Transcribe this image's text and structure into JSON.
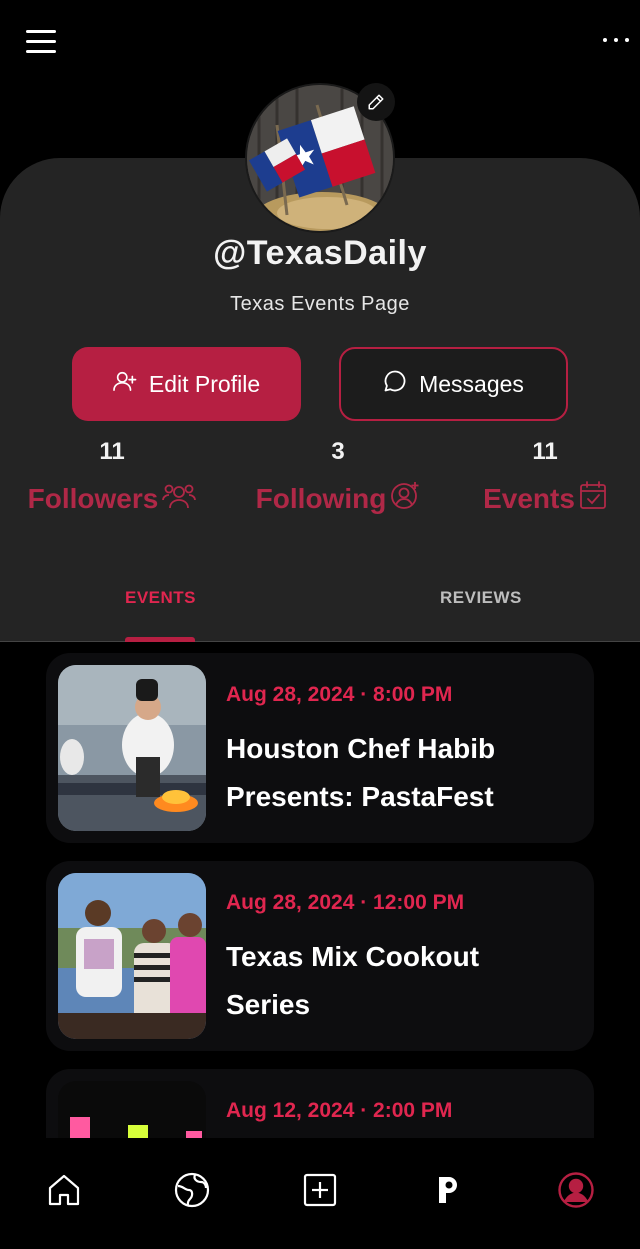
{
  "header": {
    "menu_icon": "hamburger-menu-icon",
    "more_icon": "more-dots-icon"
  },
  "profile": {
    "username": "@TexasDaily",
    "bio": "Texas Events Page",
    "edit_icon": "pencil-icon"
  },
  "buttons": {
    "edit_profile": "Edit Profile",
    "messages": "Messages"
  },
  "stats": [
    {
      "count": "11",
      "label": "Followers",
      "icon": "followers-icon"
    },
    {
      "count": "3",
      "label": "Following",
      "icon": "following-icon"
    },
    {
      "count": "11",
      "label": "Events",
      "icon": "calendar-icon"
    }
  ],
  "tabs": [
    {
      "label": "EVENTS",
      "active": true
    },
    {
      "label": "REVIEWS",
      "active": false
    }
  ],
  "events": [
    {
      "date": "Aug 28, 2024 · 8:00 PM",
      "title": "Houston Chef Habib Presents: PastaFest"
    },
    {
      "date": "Aug 28, 2024 · 12:00 PM",
      "title": "Texas Mix Cookout Series"
    },
    {
      "date": "Aug 12, 2024 · 2:00 PM",
      "title": ""
    }
  ],
  "bottom_nav": [
    {
      "name": "home",
      "icon": "home-icon"
    },
    {
      "name": "explore",
      "icon": "globe-icon"
    },
    {
      "name": "create",
      "icon": "add-square-icon"
    },
    {
      "name": "p",
      "icon": "p-logo-icon"
    },
    {
      "name": "profile",
      "icon": "profile-icon",
      "active": true
    }
  ],
  "colors": {
    "accent": "#b61f42",
    "date": "#e0264f",
    "background": "#000000",
    "card": "#242424"
  }
}
